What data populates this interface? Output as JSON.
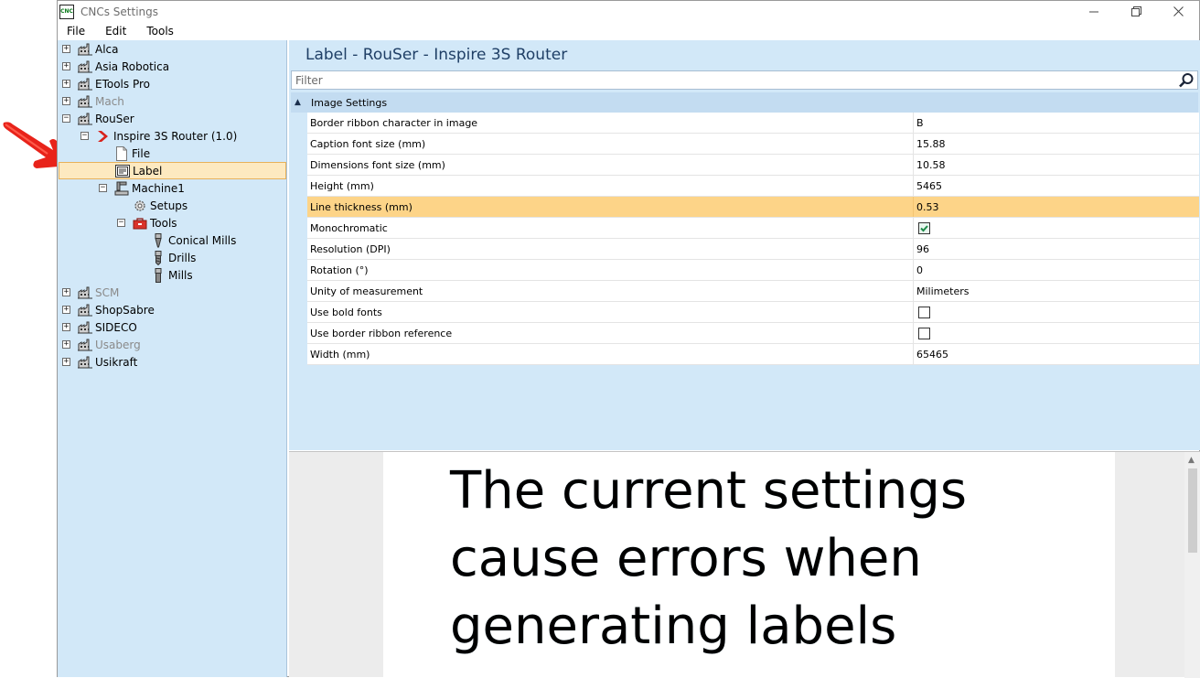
{
  "window": {
    "app_icon_text": "CNC",
    "title": "CNCs Settings"
  },
  "menu": [
    "File",
    "Edit",
    "Tools"
  ],
  "tree": [
    {
      "label": "Alca",
      "level": 0,
      "expander": "+",
      "icon": "factory-icon",
      "disabled": false
    },
    {
      "label": "Asia Robotica",
      "level": 0,
      "expander": "+",
      "icon": "factory-icon",
      "disabled": false
    },
    {
      "label": "ETools Pro",
      "level": 0,
      "expander": "+",
      "icon": "factory-icon",
      "disabled": false
    },
    {
      "label": "Mach",
      "level": 0,
      "expander": "+",
      "icon": "factory-icon",
      "disabled": true
    },
    {
      "label": "RouSer",
      "level": 0,
      "expander": "−",
      "icon": "factory-icon",
      "disabled": false
    },
    {
      "label": "Inspire 3S Router (1.0)",
      "level": 1,
      "expander": "−",
      "icon": "red-chevron-icon",
      "disabled": false
    },
    {
      "label": "File",
      "level": 2,
      "expander": "",
      "icon": "file-icon",
      "disabled": false
    },
    {
      "label": "Label",
      "level": 2,
      "expander": "",
      "icon": "label-icon",
      "disabled": false,
      "selected": true
    },
    {
      "label": "Machine1",
      "level": 2,
      "expander": "−",
      "icon": "machine-icon",
      "disabled": false
    },
    {
      "label": "Setups",
      "level": 3,
      "expander": "",
      "icon": "gear-icon",
      "disabled": false
    },
    {
      "label": "Tools",
      "level": 3,
      "expander": "−",
      "icon": "toolbox-icon",
      "disabled": false
    },
    {
      "label": "Conical Mills",
      "level": 4,
      "expander": "",
      "icon": "conical-mill-icon",
      "disabled": false
    },
    {
      "label": "Drills",
      "level": 4,
      "expander": "",
      "icon": "drill-icon",
      "disabled": false
    },
    {
      "label": "Mills",
      "level": 4,
      "expander": "",
      "icon": "mill-icon",
      "disabled": false
    },
    {
      "label": "SCM",
      "level": 0,
      "expander": "+",
      "icon": "factory-icon",
      "disabled": true
    },
    {
      "label": "ShopSabre",
      "level": 0,
      "expander": "+",
      "icon": "factory-icon",
      "disabled": false
    },
    {
      "label": "SIDECO",
      "level": 0,
      "expander": "+",
      "icon": "factory-icon",
      "disabled": false
    },
    {
      "label": "Usaberg",
      "level": 0,
      "expander": "+",
      "icon": "factory-icon",
      "disabled": true
    },
    {
      "label": "Usikraft",
      "level": 0,
      "expander": "+",
      "icon": "factory-icon",
      "disabled": false
    }
  ],
  "main": {
    "title": "Label - RouSer - Inspire 3S Router",
    "filter_placeholder": "Filter",
    "category": "Image Settings",
    "properties": [
      {
        "name": "Border ribbon character in image",
        "value": "B",
        "type": "text"
      },
      {
        "name": "Caption font size (mm)",
        "value": "15.88",
        "type": "text"
      },
      {
        "name": "Dimensions font size (mm)",
        "value": "10.58",
        "type": "text"
      },
      {
        "name": "Height (mm)",
        "value": "5465",
        "type": "text"
      },
      {
        "name": "Line thickness (mm)",
        "value": "0.53",
        "type": "text",
        "selected": true
      },
      {
        "name": "Monochromatic",
        "value": "",
        "type": "checkbox",
        "checked": true
      },
      {
        "name": "Resolution (DPI)",
        "value": "96",
        "type": "text"
      },
      {
        "name": "Rotation (°)",
        "value": "0",
        "type": "text"
      },
      {
        "name": "Unity of measurement",
        "value": "Milimeters",
        "type": "text"
      },
      {
        "name": "Use bold fonts",
        "value": "",
        "type": "checkbox",
        "checked": false
      },
      {
        "name": "Use border ribbon reference",
        "value": "",
        "type": "checkbox",
        "checked": false
      },
      {
        "name": "Width (mm)",
        "value": "65465",
        "type": "text"
      }
    ]
  },
  "preview": {
    "message": "The current settings cause errors when generating labels"
  },
  "colors": {
    "pane_bg": "#d2e8f8",
    "selected_row": "#fdd488",
    "selected_tree": "#fde9c0",
    "title_color": "#1f3f66",
    "annotation_arrow": "#e8231a"
  }
}
